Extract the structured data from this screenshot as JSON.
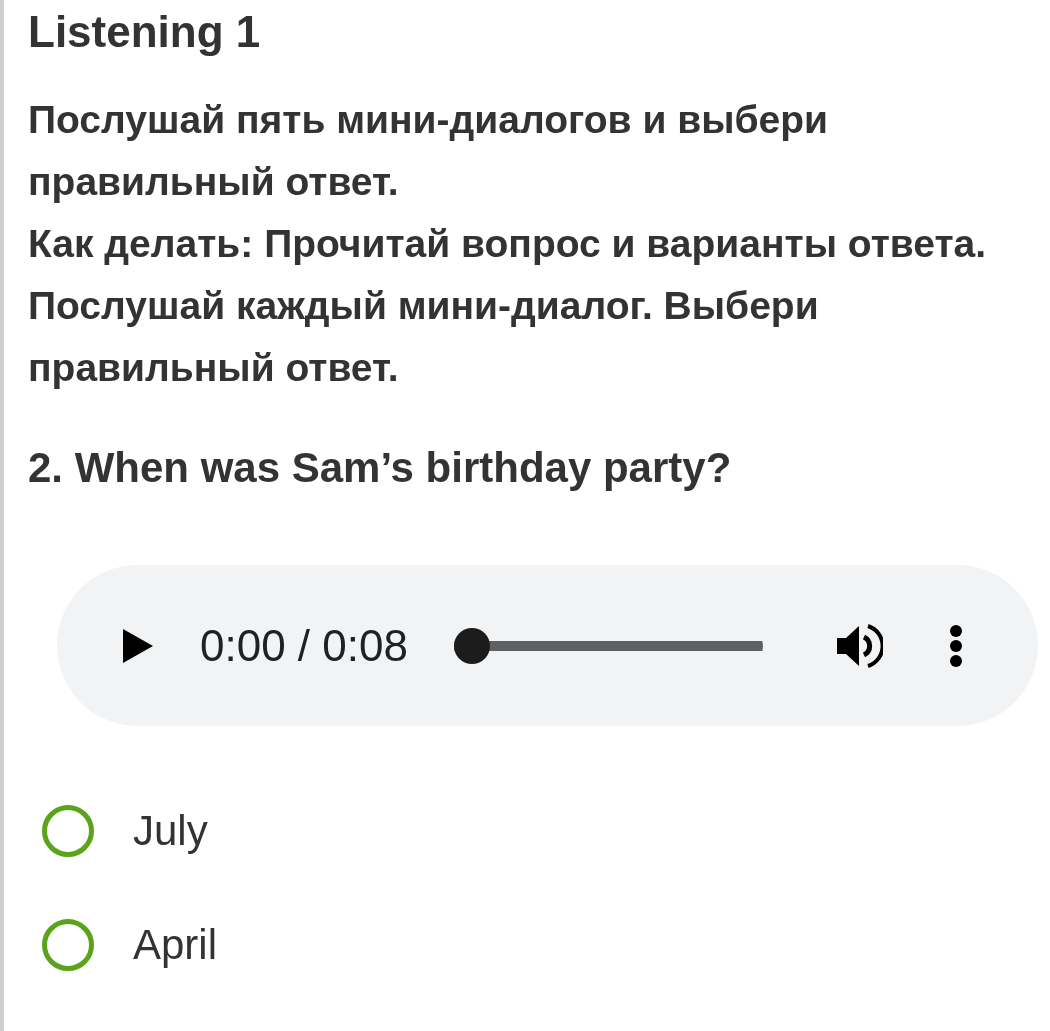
{
  "title": "Listening 1",
  "instructions": [
    "Послушай пять мини-диалогов и выбери правильный ответ.",
    "Как делать: Прочитай вопрос и варианты ответа. Послушай каждый мини-диалог. Выбери правильный ответ."
  ],
  "question": "2. When was Sam’s birthday party?",
  "player": {
    "playing": false,
    "time": "0:00 / 0:08",
    "level": 0
  },
  "options": [
    {
      "label": "July",
      "selected": false
    },
    {
      "label": "April",
      "selected": false
    }
  ]
}
